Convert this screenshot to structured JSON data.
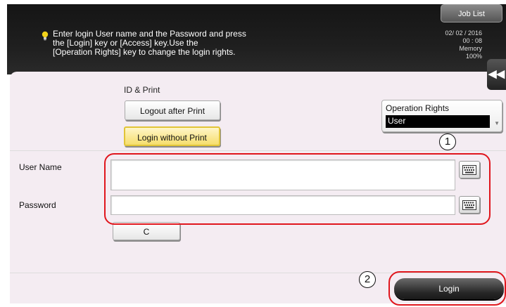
{
  "header": {
    "job_list": "Job List",
    "message": [
      "Enter login User name and the Password and press",
      "the [Login] key or [Access] key.Use the",
      "[Operation Rights] key to change the login rights."
    ],
    "date": "02/ 02 / 2016",
    "time": "00 : 08",
    "memory_label": "Memory",
    "memory_value": "100%"
  },
  "login": {
    "section_label": "ID & Print",
    "logout_after_print": "Logout after Print",
    "login_without_print": "Login without Print",
    "operation_rights": {
      "label": "Operation Rights",
      "selected": "User"
    },
    "user_name_label": "User Name",
    "user_name_value": "",
    "password_label": "Password",
    "password_value": "",
    "clear_label": "C",
    "login_button": "Login"
  },
  "callouts": {
    "first": "1",
    "second": "2"
  },
  "colors": {
    "selected_button": "#f6de6c",
    "highlight": "#e0161d",
    "message_icon": "#f2d21a"
  },
  "icons": [
    "lightbulb-icon",
    "keyboard-icon",
    "collapse-left-icon",
    "dropdown-arrow-icon"
  ]
}
